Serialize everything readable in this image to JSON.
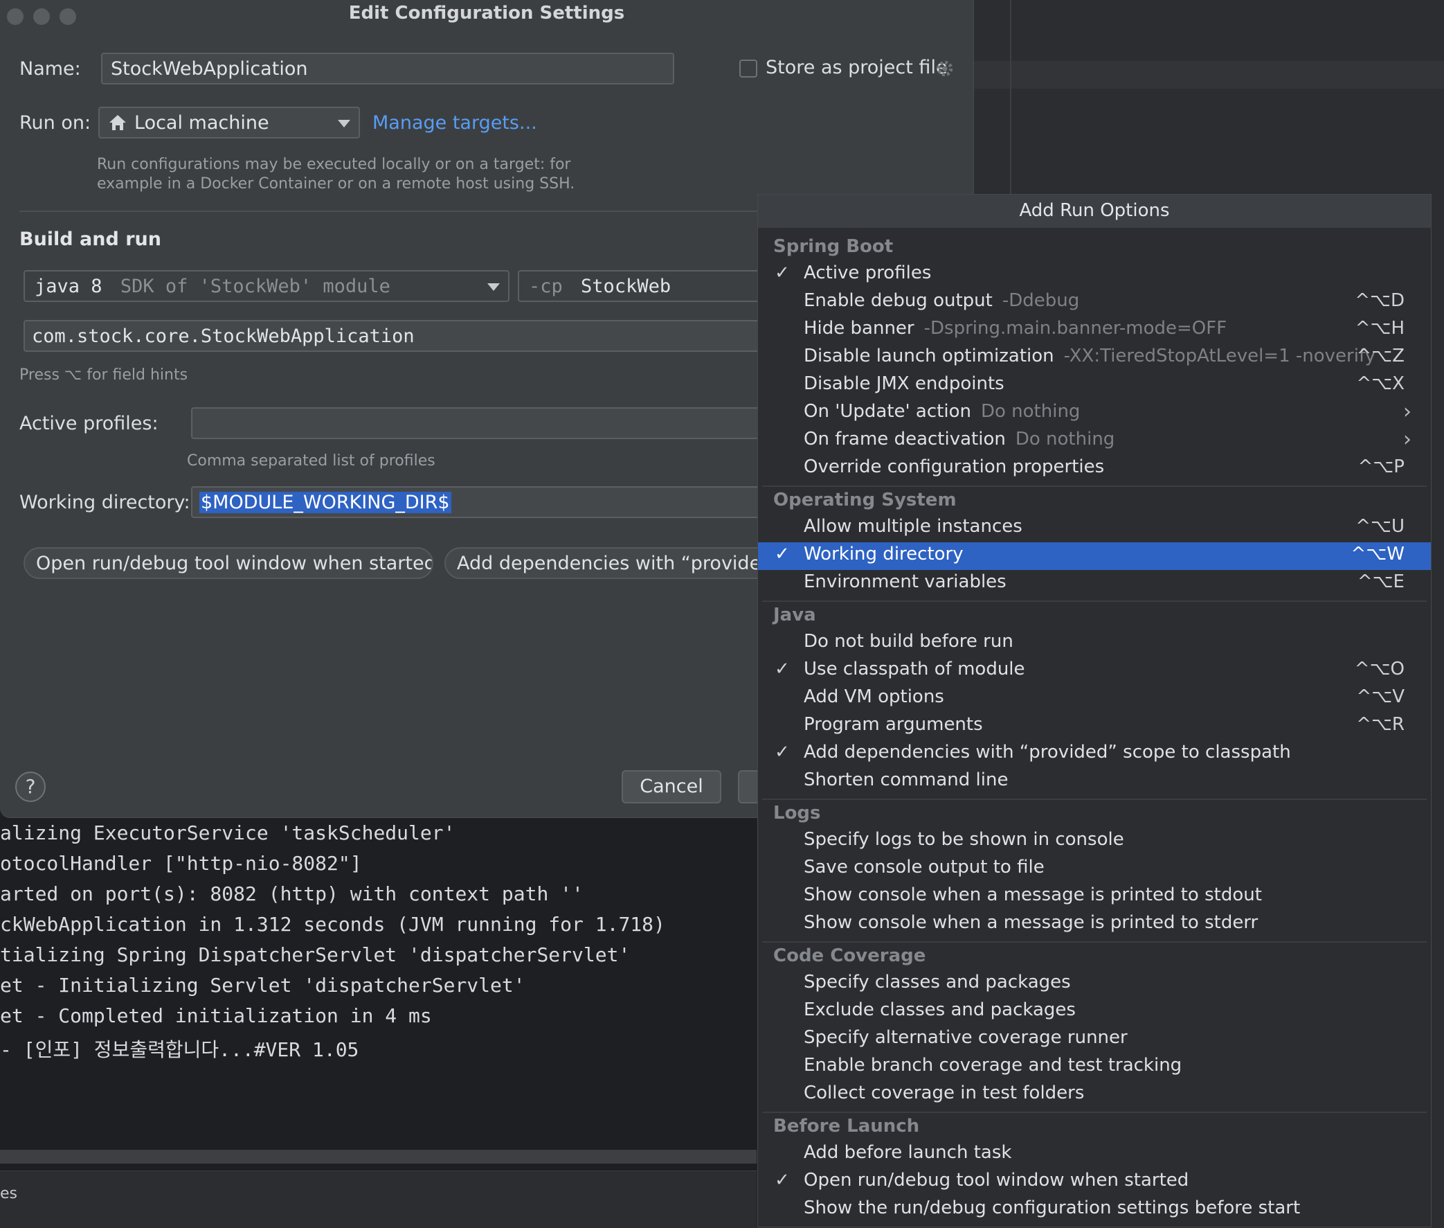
{
  "dialog": {
    "title": "Edit Configuration Settings",
    "name_label": "Name:",
    "name_value": "StockWebApplication",
    "store_label": "Store as project file",
    "run_on_label": "Run on:",
    "run_on_value": "Local machine",
    "manage_targets": "Manage targets...",
    "run_hint_line1": "Run configurations may be executed locally or on a target: for",
    "run_hint_line2": "example in a Docker Container or on a remote host using SSH.",
    "build_and_run": "Build and run",
    "sdk_java": "java 8",
    "sdk_rest": "SDK of 'StockWeb' module",
    "cp_flag": "-cp",
    "cp_value": "StockWeb",
    "main_class": "com.stock.core.StockWebApplication",
    "field_hints": "Press ⌥ for field hints",
    "active_profiles_label": "Active profiles:",
    "active_profiles_value": "",
    "active_profiles_hint": "Comma separated list of profiles",
    "working_dir_label": "Working directory:",
    "working_dir_value": "$MODULE_WORKING_DIR$",
    "chip_open_tool_window": "Open run/debug tool window when started",
    "chip_add_dependencies": "Add dependencies with “provided”",
    "cancel": "Cancel",
    "help": "?"
  },
  "popup": {
    "title": "Add Run Options",
    "groups": [
      {
        "name": "Spring Boot"
      },
      {
        "name": "Operating System"
      },
      {
        "name": "Java"
      },
      {
        "name": "Logs"
      },
      {
        "name": "Code Coverage"
      },
      {
        "name": "Before Launch"
      }
    ],
    "items": [
      {
        "label": "Active profiles",
        "hint": "",
        "shortcut": "",
        "checked": true
      },
      {
        "label": "Enable debug output",
        "hint": "-Ddebug",
        "shortcut": "^⌥D",
        "checked": false
      },
      {
        "label": "Hide banner",
        "hint": "-Dspring.main.banner-mode=OFF",
        "shortcut": "^⌥H",
        "checked": false
      },
      {
        "label": "Disable launch optimization",
        "hint": "-XX:TieredStopAtLevel=1 -noverify",
        "shortcut": "^⌥Z",
        "checked": false
      },
      {
        "label": "Disable JMX endpoints",
        "hint": "",
        "shortcut": "^⌥X",
        "checked": false
      },
      {
        "label": "On 'Update' action",
        "hint": "Do nothing",
        "shortcut": "",
        "checked": false,
        "submenu": true
      },
      {
        "label": "On frame deactivation",
        "hint": "Do nothing",
        "shortcut": "",
        "checked": false,
        "submenu": true
      },
      {
        "label": "Override configuration properties",
        "hint": "",
        "shortcut": "^⌥P",
        "checked": false
      },
      {
        "label": "Allow multiple instances",
        "hint": "",
        "shortcut": "^⌥U",
        "checked": false
      },
      {
        "label": "Working directory",
        "hint": "",
        "shortcut": "^⌥W",
        "checked": true,
        "selected": true
      },
      {
        "label": "Environment variables",
        "hint": "",
        "shortcut": "^⌥E",
        "checked": false
      },
      {
        "label": "Do not build before run",
        "hint": "",
        "shortcut": "",
        "checked": false
      },
      {
        "label": "Use classpath of module",
        "hint": "",
        "shortcut": "^⌥O",
        "checked": true
      },
      {
        "label": "Add VM options",
        "hint": "",
        "shortcut": "^⌥V",
        "checked": false
      },
      {
        "label": "Program arguments",
        "hint": "",
        "shortcut": "^⌥R",
        "checked": false
      },
      {
        "label": "Add dependencies with “provided” scope to classpath",
        "hint": "",
        "shortcut": "",
        "checked": true
      },
      {
        "label": "Shorten command line",
        "hint": "",
        "shortcut": "",
        "checked": false
      },
      {
        "label": "Specify logs to be shown in console",
        "hint": "",
        "shortcut": "",
        "checked": false
      },
      {
        "label": "Save console output to file",
        "hint": "",
        "shortcut": "",
        "checked": false
      },
      {
        "label": "Show console when a message is printed to stdout",
        "hint": "",
        "shortcut": "",
        "checked": false
      },
      {
        "label": "Show console when a message is printed to stderr",
        "hint": "",
        "shortcut": "",
        "checked": false
      },
      {
        "label": "Specify classes and packages",
        "hint": "",
        "shortcut": "",
        "checked": false
      },
      {
        "label": "Exclude classes and packages",
        "hint": "",
        "shortcut": "",
        "checked": false
      },
      {
        "label": "Specify alternative coverage runner",
        "hint": "",
        "shortcut": "",
        "checked": false
      },
      {
        "label": "Enable branch coverage and test tracking",
        "hint": "",
        "shortcut": "",
        "checked": false
      },
      {
        "label": "Collect coverage in test folders",
        "hint": "",
        "shortcut": "",
        "checked": false
      },
      {
        "label": "Add before launch task",
        "hint": "",
        "shortcut": "",
        "checked": false
      },
      {
        "label": "Open run/debug tool window when started",
        "hint": "",
        "shortcut": "",
        "checked": true
      },
      {
        "label": "Show the run/debug configuration settings before start",
        "hint": "",
        "shortcut": "",
        "checked": false
      }
    ]
  },
  "console": {
    "lines": [
      "alizing ExecutorService 'taskScheduler'",
      "otocolHandler [\"http-nio-8082\"]",
      "arted on port(s): 8082 (http) with context path ''",
      "ckWebApplication in 1.312 seconds (JVM running for 1.718)",
      "tializing Spring DispatcherServlet 'dispatcherServlet'",
      "et - Initializing Servlet 'dispatcherServlet'",
      "et - Completed initialization in 4 ms",
      "- [인포] 정보출력합니다...#VER 1.05"
    ],
    "status_text": "es"
  },
  "colors": {
    "selection": "#2e62c3",
    "link": "#589df6",
    "dialog_bg": "#3c3f41",
    "popup_bg": "#2b2d30"
  }
}
